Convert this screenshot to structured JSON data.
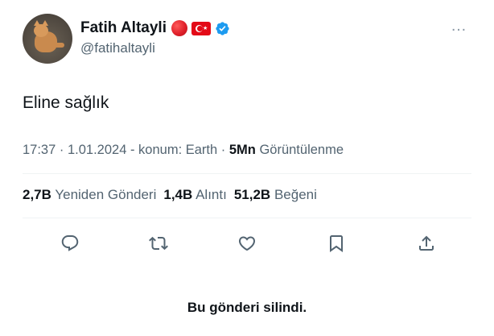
{
  "author": {
    "display_name": "Fatih Altayli",
    "handle": "@fatihaltayli",
    "badges": [
      "red-circle-emoji",
      "turkey-flag-emoji",
      "verified-badge-icon"
    ]
  },
  "more_icon": "…",
  "tweet": {
    "text": "Eline sağlık",
    "time": "17:37",
    "date": "1.01.2024",
    "location": "konum: Earth",
    "views_count": "5Mn",
    "views_label": "Görüntülenme"
  },
  "stats": {
    "reposts_count": "2,7B",
    "reposts_label": "Yeniden Gönderi",
    "quotes_count": "1,4B",
    "quotes_label": "Alıntı",
    "likes_count": "51,2B",
    "likes_label": "Beğeni"
  },
  "actions": [
    "reply-icon",
    "repost-icon",
    "like-icon",
    "bookmark-icon",
    "share-icon"
  ],
  "footer": {
    "deleted_notice": "Bu gönderi silindi."
  },
  "colors": {
    "primary_text": "#0f1419",
    "secondary_text": "#536471",
    "verified_blue": "#1d9bf0",
    "divider": "#eff3f4"
  }
}
